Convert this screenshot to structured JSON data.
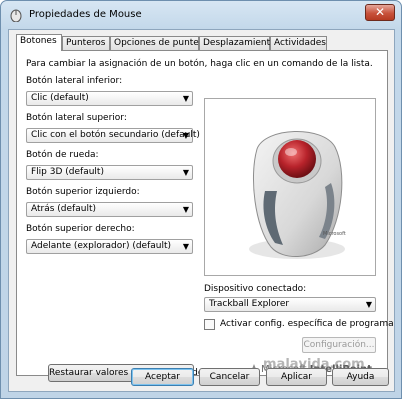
{
  "window": {
    "title": "Propiedades de Mouse",
    "close_label": "✕"
  },
  "tabs": [
    {
      "label": "Botones",
      "active": true
    },
    {
      "label": "Punteros",
      "active": false
    },
    {
      "label": "Opciones de puntero",
      "active": false
    },
    {
      "label": "Desplazamiento",
      "active": false
    },
    {
      "label": "Actividades",
      "active": false
    }
  ],
  "panel": {
    "intro": "Para cambiar la asignación de un botón, haga clic en un comando de la lista.",
    "fields": [
      {
        "label": "Botón lateral inferior:",
        "value": "Clic (default)"
      },
      {
        "label": "Botón lateral superior:",
        "value": "Clic con el botón secundario (default)"
      },
      {
        "label": "Botón de rueda:",
        "value": "Flip 3D (default)"
      },
      {
        "label": "Botón superior izquierdo:",
        "value": "Atrás (default)"
      },
      {
        "label": "Botón superior derecho:",
        "value": "Adelante (explorador) (default)"
      }
    ],
    "device": {
      "label": "Dispositivo conectado:",
      "value": "Trackball Explorer"
    },
    "program_checkbox": {
      "label": "Activar config. específica de programa",
      "checked": false
    },
    "config_button": "Configuración...",
    "restore_button": "Restaurar valores predeterminados",
    "brand": {
      "prefix": "Microsoft ",
      "name": "IntelliPoint"
    }
  },
  "footer": {
    "ok": "Aceptar",
    "cancel": "Cancelar",
    "apply": "Aplicar",
    "help": "Ayuda"
  },
  "watermark": "malavida.com",
  "icons": {
    "app": "mouse-icon",
    "brand": "intellipoint-logo-icon",
    "dropdown": "chevron-down-icon"
  },
  "colors": {
    "title_bar": "#c3d8ea",
    "close_button": "#c8523c",
    "default_button_border": "#3c7fb1",
    "trackball_ball": "#b8232b"
  }
}
